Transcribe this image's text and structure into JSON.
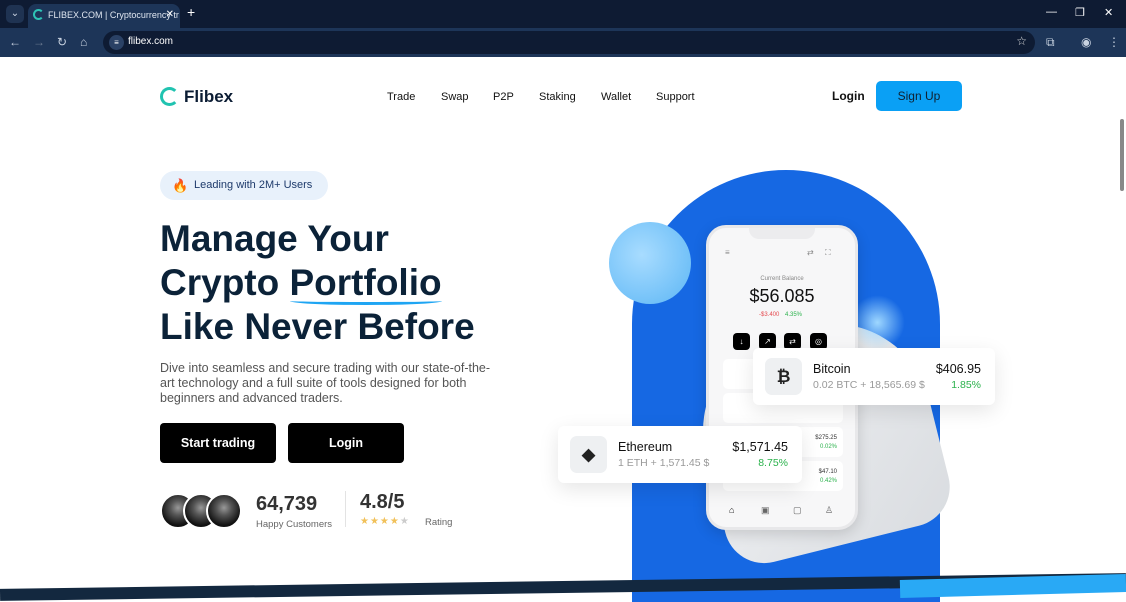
{
  "browser": {
    "tab_title": "FLIBEX.COM | Cryptocurrency tr",
    "url": "flibex.com"
  },
  "header": {
    "logo": "Flibex",
    "nav": [
      "Trade",
      "Swap",
      "P2P",
      "Staking",
      "Wallet",
      "Support"
    ],
    "login": "Login",
    "signup": "Sign Up"
  },
  "hero": {
    "badge": "Leading with 2M+ Users",
    "title_1": "Manage Your",
    "title_2a": "Crypto ",
    "title_2b": "Portfolio",
    "title_3": "Like Never Before",
    "description": "Dive into seamless and secure trading with our state-of-the-art technology and a full suite of tools designed for both beginners and advanced traders.",
    "start_trading": "Start trading",
    "login": "Login",
    "customers_count": "64,739",
    "customers_label": "Happy Customers",
    "rating": "4.8/5",
    "rating_label": "Rating",
    "rating_stars": 4
  },
  "phone": {
    "balance_label": "Current Balance",
    "balance": "$56.085",
    "change": "-$3.400",
    "change_pct": "4.35%",
    "rows": [
      {
        "price": "$275.25",
        "pct": "0.02%"
      },
      {
        "price": "$47.10",
        "pct": "0.42%"
      }
    ]
  },
  "cards": {
    "bitcoin": {
      "name": "Bitcoin",
      "sub": "0.02 BTC + 18,565.69 $",
      "price": "$406.95",
      "pct": "1.85%"
    },
    "ethereum": {
      "name": "Ethereum",
      "sub": "1 ETH + 1,571.45 $",
      "price": "$1,571.45",
      "pct": "8.75%"
    }
  },
  "colors": {
    "accent": "#0aa0f5",
    "arch": "#1668e3",
    "positive": "#2bb24c",
    "negative": "#e5484d"
  }
}
